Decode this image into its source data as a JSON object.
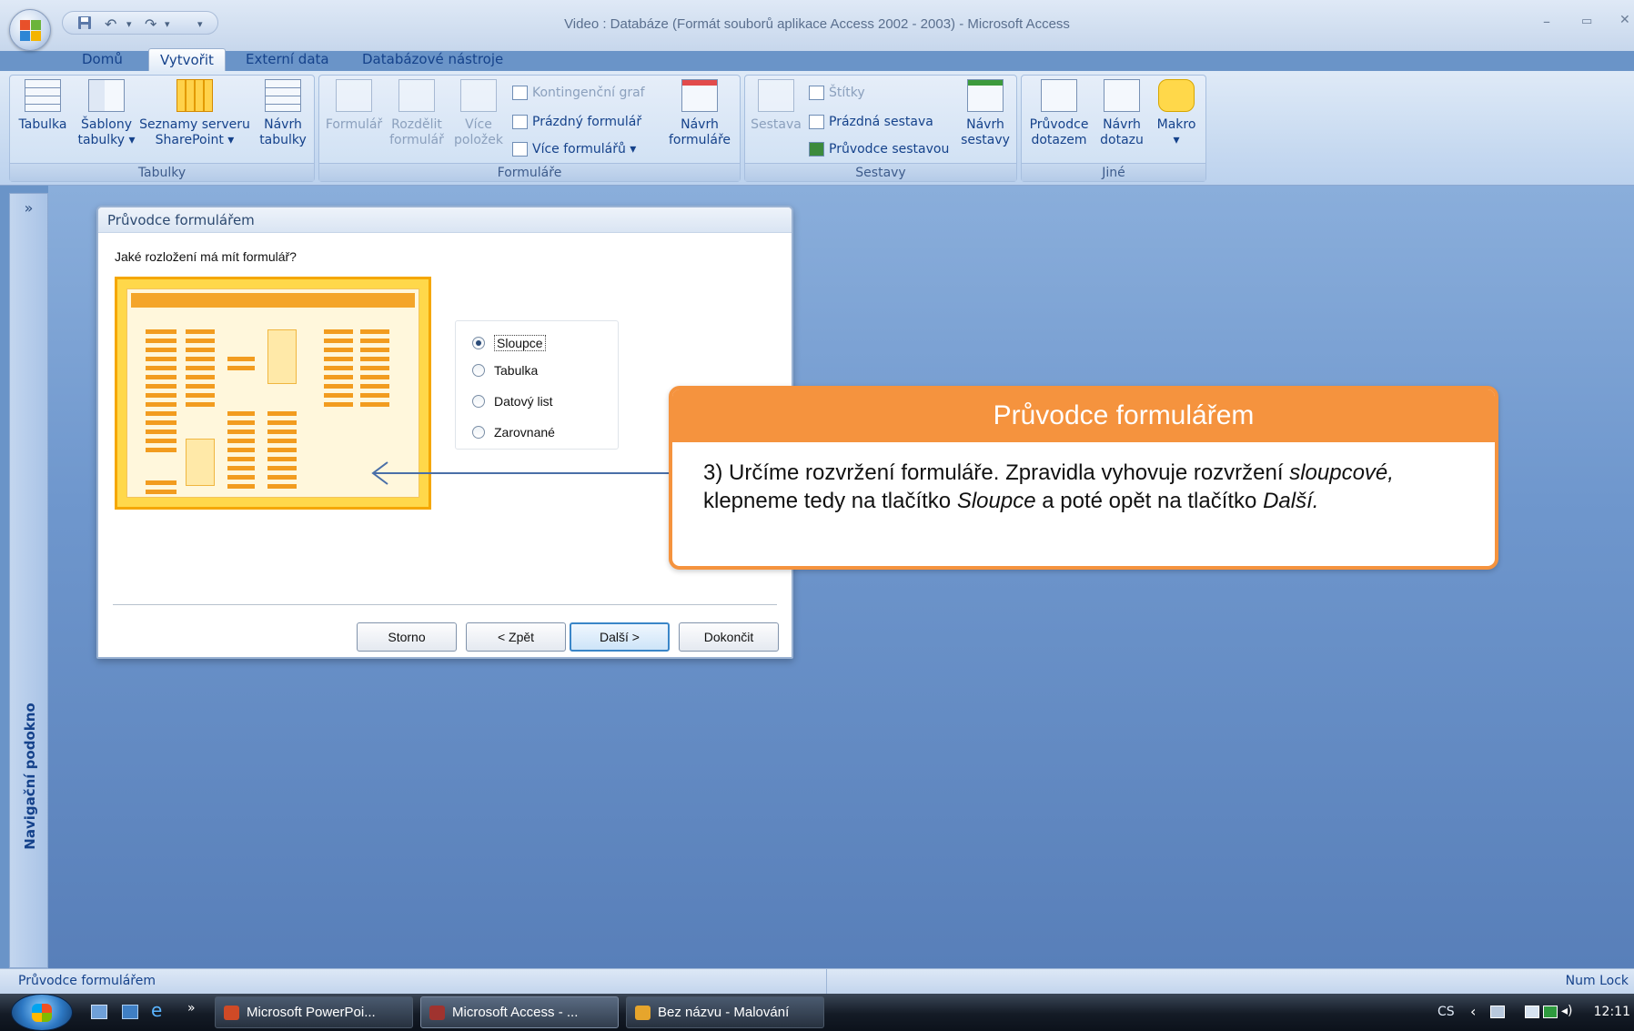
{
  "window": {
    "title": "Video : Databáze (Formát souborů aplikace Access 2002 - 2003) - Microsoft Access",
    "minimize_glyph": "–",
    "restore_glyph": "▭",
    "close_glyph": "✕"
  },
  "qat": {
    "save_icon": "save-icon",
    "undo_glyph": "↶",
    "redo_glyph": "↷",
    "customize_glyph": "▾"
  },
  "tabs": [
    "Domů",
    "Vytvořit",
    "Externí data",
    "Databázové nástroje"
  ],
  "active_tab": "Vytvořit",
  "ribbon": {
    "groups": {
      "tabulky": "Tabulky",
      "formulare": "Formuláře",
      "sestavy": "Sestavy",
      "jine": "Jiné"
    },
    "tabulky": {
      "tabulka": "Tabulka",
      "sablony_1": "Šablony",
      "sablony_2": "tabulky ▾",
      "seznamy_1": "Seznamy serveru",
      "seznamy_2": "SharePoint ▾",
      "navrh_1": "Návrh",
      "navrh_2": "tabulky"
    },
    "formulare": {
      "formular": "Formulář",
      "rozdelit_1": "Rozdělit",
      "rozdelit_2": "formulář",
      "vice_1": "Více",
      "vice_2": "položek",
      "kontingencni": "Kontingenční graf",
      "prazdny": "Prázdný formulář",
      "vice_formularu": "Více formulářů ▾",
      "navrh_1": "Návrh",
      "navrh_2": "formuláře"
    },
    "sestavy": {
      "sestava": "Sestava",
      "stitky": "Štítky",
      "prazdna": "Prázdná sestava",
      "pruvodce": "Průvodce sestavou",
      "navrh_1": "Návrh",
      "navrh_2": "sestavy"
    },
    "jine": {
      "pruvodce_1": "Průvodce",
      "pruvodce_2": "dotazem",
      "navrh_1": "Návrh",
      "navrh_2": "dotazu",
      "makro_1": "Makro",
      "makro_2": "▾"
    }
  },
  "nav_pane": {
    "label": "Navigační podokno",
    "chevron": "»"
  },
  "dialog": {
    "title": "Průvodce formulářem",
    "question": "Jaké rozložení má mít formulář?",
    "options": [
      {
        "label": "Sloupce",
        "checked": true
      },
      {
        "label": "Tabulka",
        "checked": false
      },
      {
        "label": "Datový list",
        "checked": false
      },
      {
        "label": "Zarovnané",
        "checked": false
      }
    ],
    "buttons": {
      "cancel": "Storno",
      "back": "< Zpět",
      "next": "Další >",
      "finish": "Dokončit"
    }
  },
  "callout": {
    "title": "Průvodce formulářem",
    "text_1": "3) Určíme rozvržení formuláře. Zpravidla vyhovuje rozvržení ",
    "text_2": "sloupcové,",
    "text_3": " klepneme tedy na tlačítko ",
    "text_4": "Sloupce",
    "text_5": " a poté opět na tlačítko ",
    "text_6": "Další."
  },
  "statusbar": {
    "left": "Průvodce formulářem",
    "right": "Num Lock"
  },
  "taskbar": {
    "quicklaunch_more": "»",
    "tasks": [
      "Microsoft PowerPoi...",
      "Microsoft Access - ...",
      "Bez názvu - Malování"
    ],
    "language": "CS",
    "tray_chevron": "‹",
    "clock": "12:11"
  },
  "colors": {
    "accent": "#f5933e",
    "ribbon_text": "#15428b",
    "preview_orange": "#f29c1f"
  }
}
